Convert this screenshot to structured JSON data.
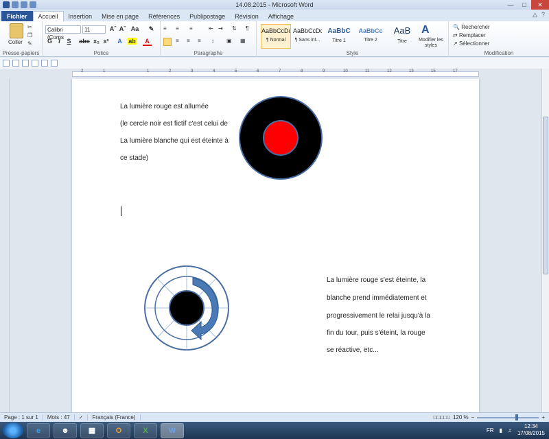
{
  "window": {
    "title": "14.08.2015 - Microsoft Word"
  },
  "ribbon_tabs": [
    "Fichier",
    "Accueil",
    "Insertion",
    "Mise en page",
    "Références",
    "Publipostage",
    "Révision",
    "Affichage"
  ],
  "ribbon": {
    "clipboard": {
      "paste_label": "Coller",
      "group_label": "Presse-papiers"
    },
    "font": {
      "font_name": "Calibri (Corps",
      "font_size": "11",
      "group_label": "Police"
    },
    "paragraph": {
      "group_label": "Paragraphe"
    },
    "styles": {
      "group_label": "Style",
      "items": [
        {
          "sample": "AaBbCcDc",
          "name": "¶ Normal"
        },
        {
          "sample": "AaBbCcDc",
          "name": "¶ Sans int..."
        },
        {
          "sample": "AaBbC",
          "name": "Titre 1"
        },
        {
          "sample": "AaBbCc",
          "name": "Titre 2"
        },
        {
          "sample": "AaB",
          "name": "Titre"
        }
      ],
      "modify_label": "Modifier les styles"
    },
    "editing": {
      "search": "Rechercher",
      "replace": "Remplacer",
      "select": "Sélectionner",
      "group_label": "Modification"
    }
  },
  "document": {
    "top_paragraph": [
      "La lumière rouge est allumée",
      "(le cercle noir est fictif c'est celui de",
      "La lumière blanche qui est éteinte à",
      "ce stade)"
    ],
    "bottom_paragraph": [
      "La lumière rouge s'est éteinte, la",
      "blanche prend immédiatement et",
      "progressivement le relai jusqu'à la",
      "fin du tour, puis s'éteint, la rouge",
      "se réactive, etc..."
    ]
  },
  "statusbar": {
    "page": "Page : 1 sur 1",
    "words": "Mots : 47",
    "language": "Français (France)",
    "zoom": "120 %"
  },
  "taskbar": {
    "lang": "FR",
    "time": "12:34",
    "date": "17/08/2015"
  },
  "colors": {
    "accent": "#2b579a",
    "red_light": "#ff0000",
    "ring_stroke": "#4a6fa5"
  }
}
